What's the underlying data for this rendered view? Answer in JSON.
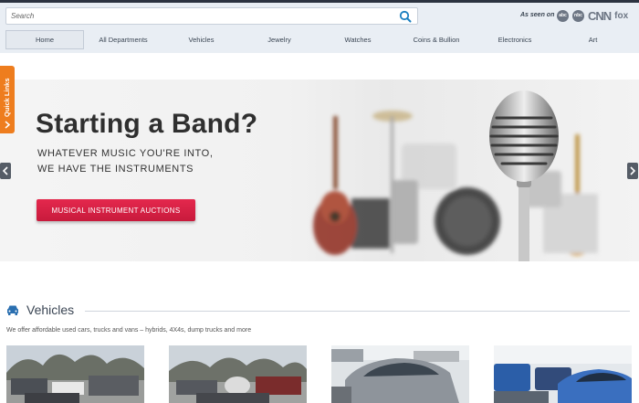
{
  "header": {
    "search_placeholder": "Search",
    "as_seen_on": "As seen on",
    "media_logos": [
      "abc",
      "nbc",
      "CNN",
      "fox"
    ]
  },
  "nav": {
    "items": [
      "Home",
      "All Departments",
      "Vehicles",
      "Jewelry",
      "Watches",
      "Coins & Bullion",
      "Electronics",
      "Art"
    ],
    "active": "Home"
  },
  "quick_links": {
    "label": "Quick Links"
  },
  "hero": {
    "title": "Starting a Band?",
    "subtitle_line1": "WHATEVER MUSIC YOU'RE INTO,",
    "subtitle_line2": "WE HAVE THE INSTRUMENTS",
    "cta_label": "MUSICAL INSTRUMENT AUCTIONS"
  },
  "vehicles_section": {
    "title": "Vehicles",
    "description": "We offer affordable used cars, trucks and vans – hybrids, 4X4s, dump trucks and more",
    "cards": [
      "vehicle-lot-photo-1",
      "vehicle-lot-photo-2",
      "silver-car-photo",
      "blue-cars-photo"
    ]
  },
  "colors": {
    "header_bg": "#e9eef4",
    "accent_blue": "#1b7fc0",
    "cta_red": "#d91f44",
    "quick_links_orange": "#ee7d1e",
    "text_dark": "#3b4654"
  }
}
